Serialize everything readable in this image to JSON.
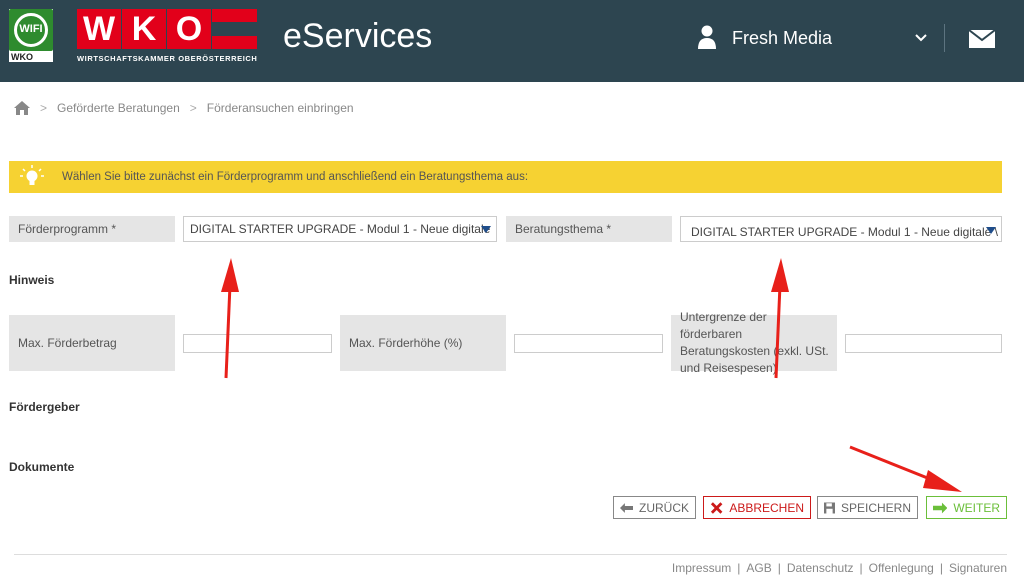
{
  "header": {
    "wifi_logo_text": "WIFI",
    "wifi_logo_sub": "WKO",
    "wko_logo_letters": [
      "W",
      "K",
      "O"
    ],
    "wko_logo_subtitle": "WIRTSCHAFTSKAMMER OBERÖSTERREICH",
    "app_title": "eServices",
    "user_name": "Fresh Media",
    "user_icon": "user-icon",
    "dropdown_icon": "chevron-down-icon",
    "mail_icon": "mail-icon"
  },
  "breadcrumb": {
    "home_icon": "home-icon",
    "items": [
      "Geförderte Beratungen",
      "Förderansuchen einbringen"
    ],
    "separator": ">"
  },
  "hint": {
    "icon": "lightbulb-icon",
    "text": "Wählen Sie bitte zunächst ein Förderprogramm und anschließend ein Beratungsthema aus:"
  },
  "form": {
    "foerderprogramm_label": "Förderprogramm *",
    "foerderprogramm_value": "DIGITAL STARTER UPGRADE - Modul 1 - Neue digitale",
    "beratungsthema_label": "Beratungsthema *",
    "beratungsthema_value": "DIGITAL STARTER UPGRADE - Modul 1 - Neue digitale \\",
    "hinweis_title": "Hinweis",
    "max_foerderbetrag_label": "Max. Förderbetrag",
    "max_foerderbetrag_value": "",
    "max_foerderhoehe_label": "Max. Förderhöhe (%)",
    "max_foerderhoehe_value": "",
    "untergrenze_label": "Untergrenze der förderbaren Beratungskosten (exkl. USt. und Reisespesen)",
    "untergrenze_value": "",
    "foerdergeber_title": "Fördergeber",
    "dokumente_title": "Dokumente"
  },
  "buttons": {
    "back": "ZURÜCK",
    "cancel": "ABBRECHEN",
    "save": "SPEICHERN",
    "next": "WEITER"
  },
  "footer": {
    "links": [
      "Impressum",
      "AGB",
      "Datenschutz",
      "Offenlegung",
      "Signaturen"
    ],
    "separator": "|"
  },
  "colors": {
    "header_bg": "#2d4550",
    "wko_red": "#e2001a",
    "hint_yellow": "#f6d232",
    "next_green": "#6bbf3a",
    "cancel_red": "#cc1a1a",
    "annotation_arrow": "#e8201a"
  }
}
